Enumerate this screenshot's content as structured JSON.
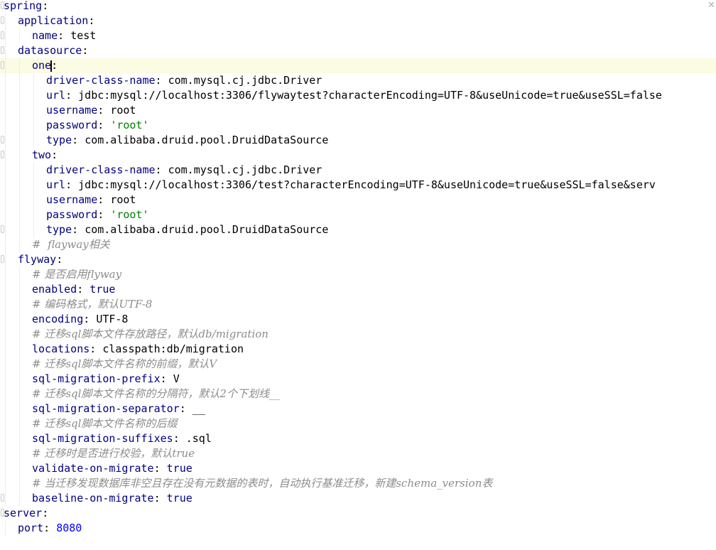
{
  "editor": {
    "lines": [
      {
        "indent": 0,
        "fold": true,
        "key": "spring",
        "sep": ":",
        "value": ""
      },
      {
        "indent": 1,
        "fold": true,
        "key": "application",
        "sep": ":",
        "value": ""
      },
      {
        "indent": 2,
        "fold": true,
        "key": "name",
        "sep": ": ",
        "value": "test",
        "vtype": "v"
      },
      {
        "indent": 1,
        "fold": true,
        "key": "datasource",
        "sep": ":",
        "value": ""
      },
      {
        "indent": 2,
        "fold": true,
        "key": "one",
        "sep": ":",
        "value": "",
        "current": true,
        "caret": true
      },
      {
        "indent": 3,
        "fold": false,
        "key": "driver-class-name",
        "sep": ": ",
        "value": "com.mysql.cj.jdbc.Driver",
        "vtype": "v"
      },
      {
        "indent": 3,
        "fold": false,
        "key": "url",
        "sep": ": ",
        "value": "jdbc:mysql://localhost:3306/flywaytest?characterEncoding=UTF-8&useUnicode=true&useSSL=false",
        "vtype": "v"
      },
      {
        "indent": 3,
        "fold": false,
        "key": "username",
        "sep": ": ",
        "value": "root",
        "vtype": "v"
      },
      {
        "indent": 3,
        "fold": false,
        "key": "password",
        "sep": ": ",
        "value": "'root'",
        "vtype": "s"
      },
      {
        "indent": 3,
        "fold": true,
        "key": "type",
        "sep": ": ",
        "value": "com.alibaba.druid.pool.DruidDataSource",
        "vtype": "v"
      },
      {
        "indent": 2,
        "fold": true,
        "key": "two",
        "sep": ":",
        "value": ""
      },
      {
        "indent": 3,
        "fold": false,
        "key": "driver-class-name",
        "sep": ": ",
        "value": "com.mysql.cj.jdbc.Driver",
        "vtype": "v"
      },
      {
        "indent": 3,
        "fold": false,
        "key": "url",
        "sep": ": ",
        "value": "jdbc:mysql://localhost:3306/test?characterEncoding=UTF-8&useUnicode=true&useSSL=false&serv",
        "vtype": "v"
      },
      {
        "indent": 3,
        "fold": false,
        "key": "username",
        "sep": ": ",
        "value": "root",
        "vtype": "v"
      },
      {
        "indent": 3,
        "fold": false,
        "key": "password",
        "sep": ": ",
        "value": "'root'",
        "vtype": "s"
      },
      {
        "indent": 3,
        "fold": true,
        "key": "type",
        "sep": ": ",
        "value": "com.alibaba.druid.pool.DruidDataSource",
        "vtype": "v"
      },
      {
        "indent": 2,
        "fold": false,
        "comment": "#  flayway相关"
      },
      {
        "indent": 1,
        "fold": true,
        "key": "flyway",
        "sep": ":",
        "value": ""
      },
      {
        "indent": 2,
        "fold": false,
        "comment": "# 是否启用flyway"
      },
      {
        "indent": 2,
        "fold": false,
        "key": "enabled",
        "sep": ": ",
        "value": "true",
        "vtype": "b"
      },
      {
        "indent": 2,
        "fold": false,
        "comment": "# 编码格式，默认UTF-8"
      },
      {
        "indent": 2,
        "fold": false,
        "key": "encoding",
        "sep": ": ",
        "value": "UTF-8",
        "vtype": "v"
      },
      {
        "indent": 2,
        "fold": false,
        "comment": "# 迁移sql脚本文件存放路径，默认db/migration"
      },
      {
        "indent": 2,
        "fold": false,
        "key": "locations",
        "sep": ": ",
        "value": "classpath:db/migration",
        "vtype": "v"
      },
      {
        "indent": 2,
        "fold": false,
        "comment": "# 迁移sql脚本文件名称的前缀，默认V"
      },
      {
        "indent": 2,
        "fold": false,
        "key": "sql-migration-prefix",
        "sep": ": ",
        "value": "V",
        "vtype": "v"
      },
      {
        "indent": 2,
        "fold": false,
        "comment": "# 迁移sql脚本文件名称的分隔符，默认2个下划线__"
      },
      {
        "indent": 2,
        "fold": false,
        "key": "sql-migration-separator",
        "sep": ": ",
        "value": "__",
        "vtype": "v"
      },
      {
        "indent": 2,
        "fold": false,
        "comment": "# 迁移sql脚本文件名称的后缀"
      },
      {
        "indent": 2,
        "fold": false,
        "key": "sql-migration-suffixes",
        "sep": ": ",
        "value": ".sql",
        "vtype": "v"
      },
      {
        "indent": 2,
        "fold": false,
        "comment": "# 迁移时是否进行校验，默认true"
      },
      {
        "indent": 2,
        "fold": false,
        "key": "validate-on-migrate",
        "sep": ": ",
        "value": "true",
        "vtype": "b"
      },
      {
        "indent": 2,
        "fold": false,
        "comment": "# 当迁移发现数据库非空且存在没有元数据的表时，自动执行基准迁移，新建schema_version表"
      },
      {
        "indent": 2,
        "fold": true,
        "key": "baseline-on-migrate",
        "sep": ": ",
        "value": "true",
        "vtype": "b"
      },
      {
        "indent": 0,
        "fold": true,
        "key": "server",
        "sep": ":",
        "value": ""
      },
      {
        "indent": 1,
        "fold": false,
        "key": "port",
        "sep": ": ",
        "value": "8080",
        "vtype": "n"
      }
    ]
  }
}
